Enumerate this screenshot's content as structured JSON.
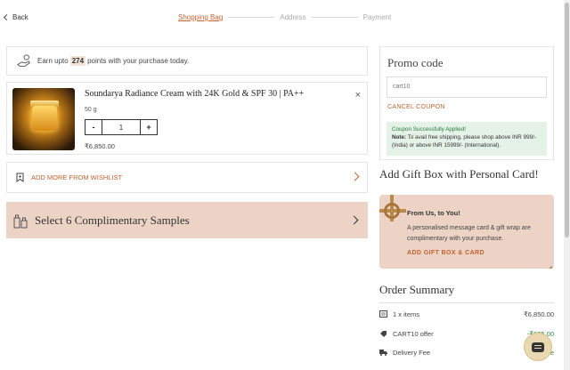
{
  "header": {
    "back_label": "Back",
    "steps": [
      "Shopping Bag",
      "Address",
      "Payment"
    ]
  },
  "points": {
    "prefix": "Earn upto",
    "value": "274",
    "suffix": "points with your purchase today."
  },
  "product": {
    "title": "Soundarya Radiance Cream with 24K Gold & SPF 30 | PA++",
    "size": "50 g",
    "quantity": "1",
    "minus": "-",
    "plus": "+",
    "price": "₹6,850.00",
    "close": "×"
  },
  "wishlist": {
    "label": "ADD MORE FROM WISHLIST"
  },
  "samples": {
    "label": "Select 6 Complimentary Samples"
  },
  "promo": {
    "title": "Promo code",
    "code": "cart10",
    "cancel": "CANCEL COUPON",
    "success": "Coupon Successfully Applied!",
    "note_label": "Note:",
    "note_text": "To avail free shipping, please shop above INR 999/- (India) or above INR 15999/- (International)."
  },
  "gift": {
    "heading": "Add Gift Box with Personal Card!",
    "from": "From Us, to You!",
    "desc": "A personalised message card & gift wrap are complimentary with your purchase.",
    "add": "ADD GIFT BOX & CARD"
  },
  "summary": {
    "heading": "Order Summary",
    "rows": [
      {
        "label": "1 x items",
        "value": "₹6,850.00"
      },
      {
        "label": "CART10 offer",
        "value": "-₹685.00"
      },
      {
        "label": "Delivery Fee",
        "value": "Free"
      }
    ]
  },
  "colors": {
    "accent": "#c2622f",
    "blush": "#ecd3c6",
    "success_bg": "#e4f2e7"
  }
}
